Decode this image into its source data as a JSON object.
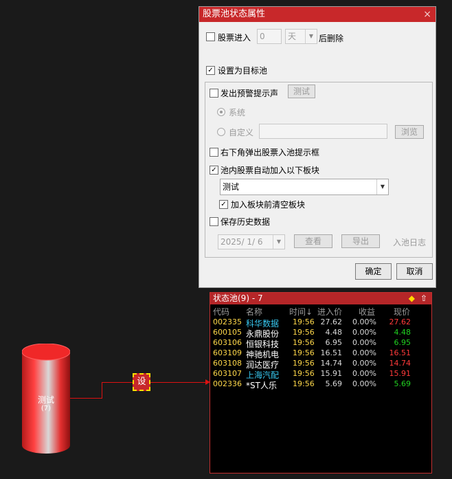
{
  "dialog": {
    "title": "股票池状态属性",
    "close_glyph": "×",
    "stock_enter": {
      "label": "股票进入",
      "checked": false,
      "days_value": "0",
      "unit": "天",
      "suffix": "后删除"
    },
    "set_target": {
      "label": "设置为目标池",
      "checked": true
    },
    "alert_sound": {
      "label": "发出预警提示声",
      "checked": false,
      "test_button": "测试"
    },
    "sound_system": {
      "label": "系统",
      "selected": true
    },
    "sound_custom": {
      "label": "自定义",
      "selected": false,
      "path_value": "",
      "browse_button": "浏览"
    },
    "popup": {
      "label": "右下角弹出股票入池提示框",
      "checked": false
    },
    "auto_add": {
      "label": "池内股票自动加入以下板块",
      "checked": true
    },
    "block_select": {
      "value": "测试"
    },
    "clear_before": {
      "label": "加入板块前清空板块",
      "checked": true
    },
    "save_history": {
      "label": "保存历史数据",
      "checked": false
    },
    "history_date": "2025/ 1/ 6",
    "view_button": "查看",
    "export_button": "导出",
    "log_label": "入池日志",
    "ok_button": "确定",
    "cancel_button": "取消",
    "check_glyph": "✓"
  },
  "pool": {
    "title": "状态池(9) - 7",
    "diamond_icon": "◆",
    "up_icon": "⇧",
    "columns": [
      "代码",
      "名称",
      "时间↓",
      "进入价",
      "收益",
      "现价"
    ],
    "rows": [
      {
        "code": "002335",
        "name": "科华数据",
        "time": "19:56",
        "price": "27.62",
        "gain": "0.00%",
        "current": "27.62",
        "name_color": "#38c8f0",
        "current_color": "#ff3a3a"
      },
      {
        "code": "600105",
        "name": "永鼎股份",
        "time": "19:56",
        "price": "4.48",
        "gain": "0.00%",
        "current": "4.48",
        "name_color": "#ffffff",
        "current_color": "#20d020"
      },
      {
        "code": "603106",
        "name": "恒银科技",
        "time": "19:56",
        "price": "6.95",
        "gain": "0.00%",
        "current": "6.95",
        "name_color": "#ffffff",
        "current_color": "#20d020"
      },
      {
        "code": "603109",
        "name": "神驰机电",
        "time": "19:56",
        "price": "16.51",
        "gain": "0.00%",
        "current": "16.51",
        "name_color": "#ffffff",
        "current_color": "#ff3a3a"
      },
      {
        "code": "603108",
        "name": "润达医疗",
        "time": "19:56",
        "price": "14.74",
        "gain": "0.00%",
        "current": "14.74",
        "name_color": "#ffffff",
        "current_color": "#ff3a3a"
      },
      {
        "code": "603107",
        "name": "上海汽配",
        "time": "19:56",
        "price": "15.91",
        "gain": "0.00%",
        "current": "15.91",
        "name_color": "#38c8f0",
        "current_color": "#ff3a3a"
      },
      {
        "code": "002336",
        "name": "*ST人乐",
        "time": "19:56",
        "price": "5.69",
        "gain": "0.00%",
        "current": "5.69",
        "name_color": "#ffffff",
        "current_color": "#20d020"
      }
    ]
  },
  "diagram": {
    "cylinder_label": "测试",
    "cylinder_count": "(7)",
    "node_label": "设"
  }
}
